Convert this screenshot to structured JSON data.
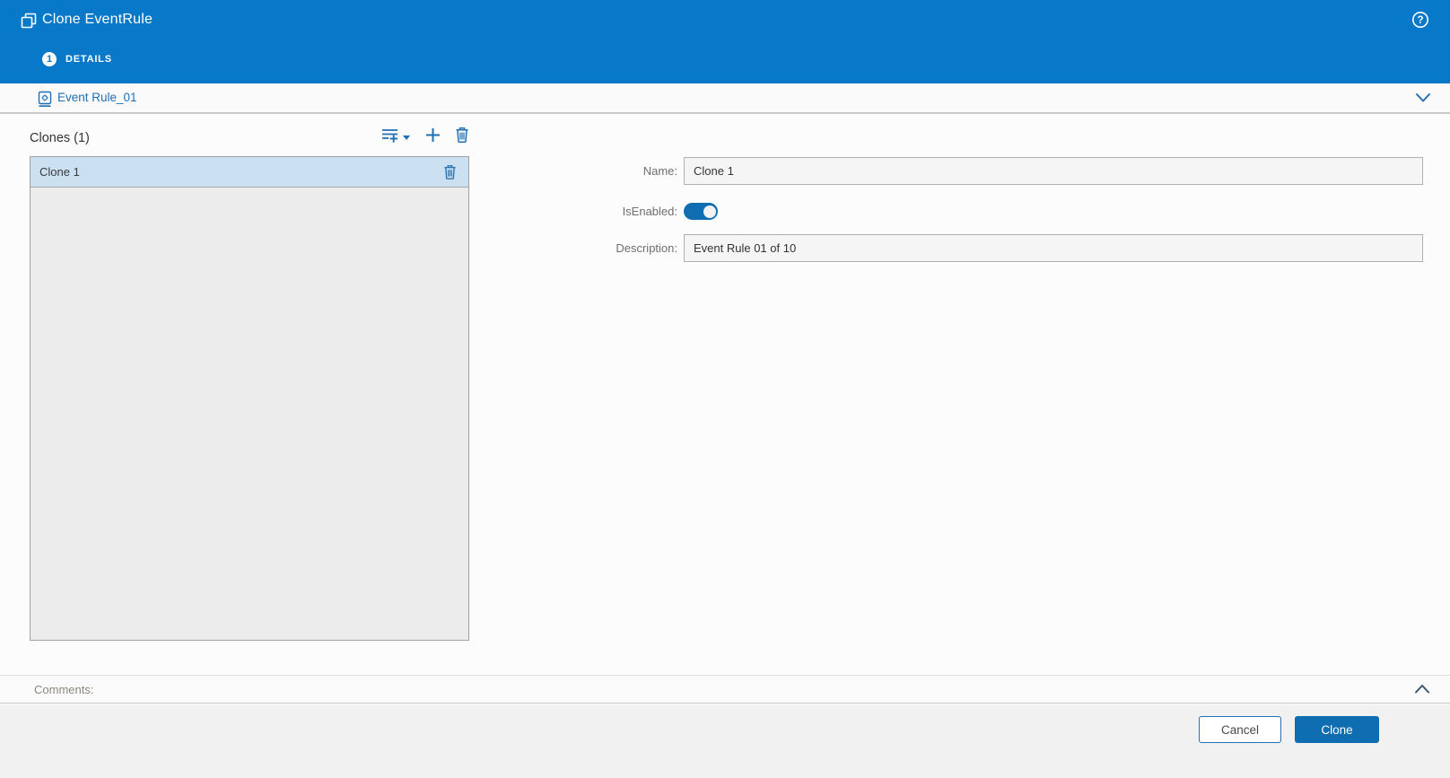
{
  "colors": {
    "header_blue": "#0878c8",
    "accent_blue": "#1f6fb5",
    "selected_row_blue": "#cbe1f2",
    "clone_button_blue": "#0f6db2",
    "list_background": "#ececec",
    "input_background": "#f5f5f5"
  },
  "header": {
    "title": "Clone EventRule",
    "steps": [
      {
        "number": "1",
        "label": "DETAILS"
      }
    ]
  },
  "source_rule": {
    "name": "Event Rule_01"
  },
  "clones_panel": {
    "title": "Clones (1)",
    "toolbar_icons": [
      "add-multiple-icon",
      "dropdown-caret-icon",
      "plus-icon",
      "trash-icon"
    ],
    "items": [
      {
        "name": "Clone 1",
        "selected": true
      }
    ]
  },
  "form": {
    "name_label": "Name:",
    "name_value": "Clone 1",
    "enabled_label": "IsEnabled:",
    "enabled_state": "on",
    "description_label": "Description:",
    "description_value": "Event Rule 01 of 10"
  },
  "comments": {
    "label": "Comments:"
  },
  "footer": {
    "cancel_label": "Cancel",
    "clone_label": "Clone"
  }
}
